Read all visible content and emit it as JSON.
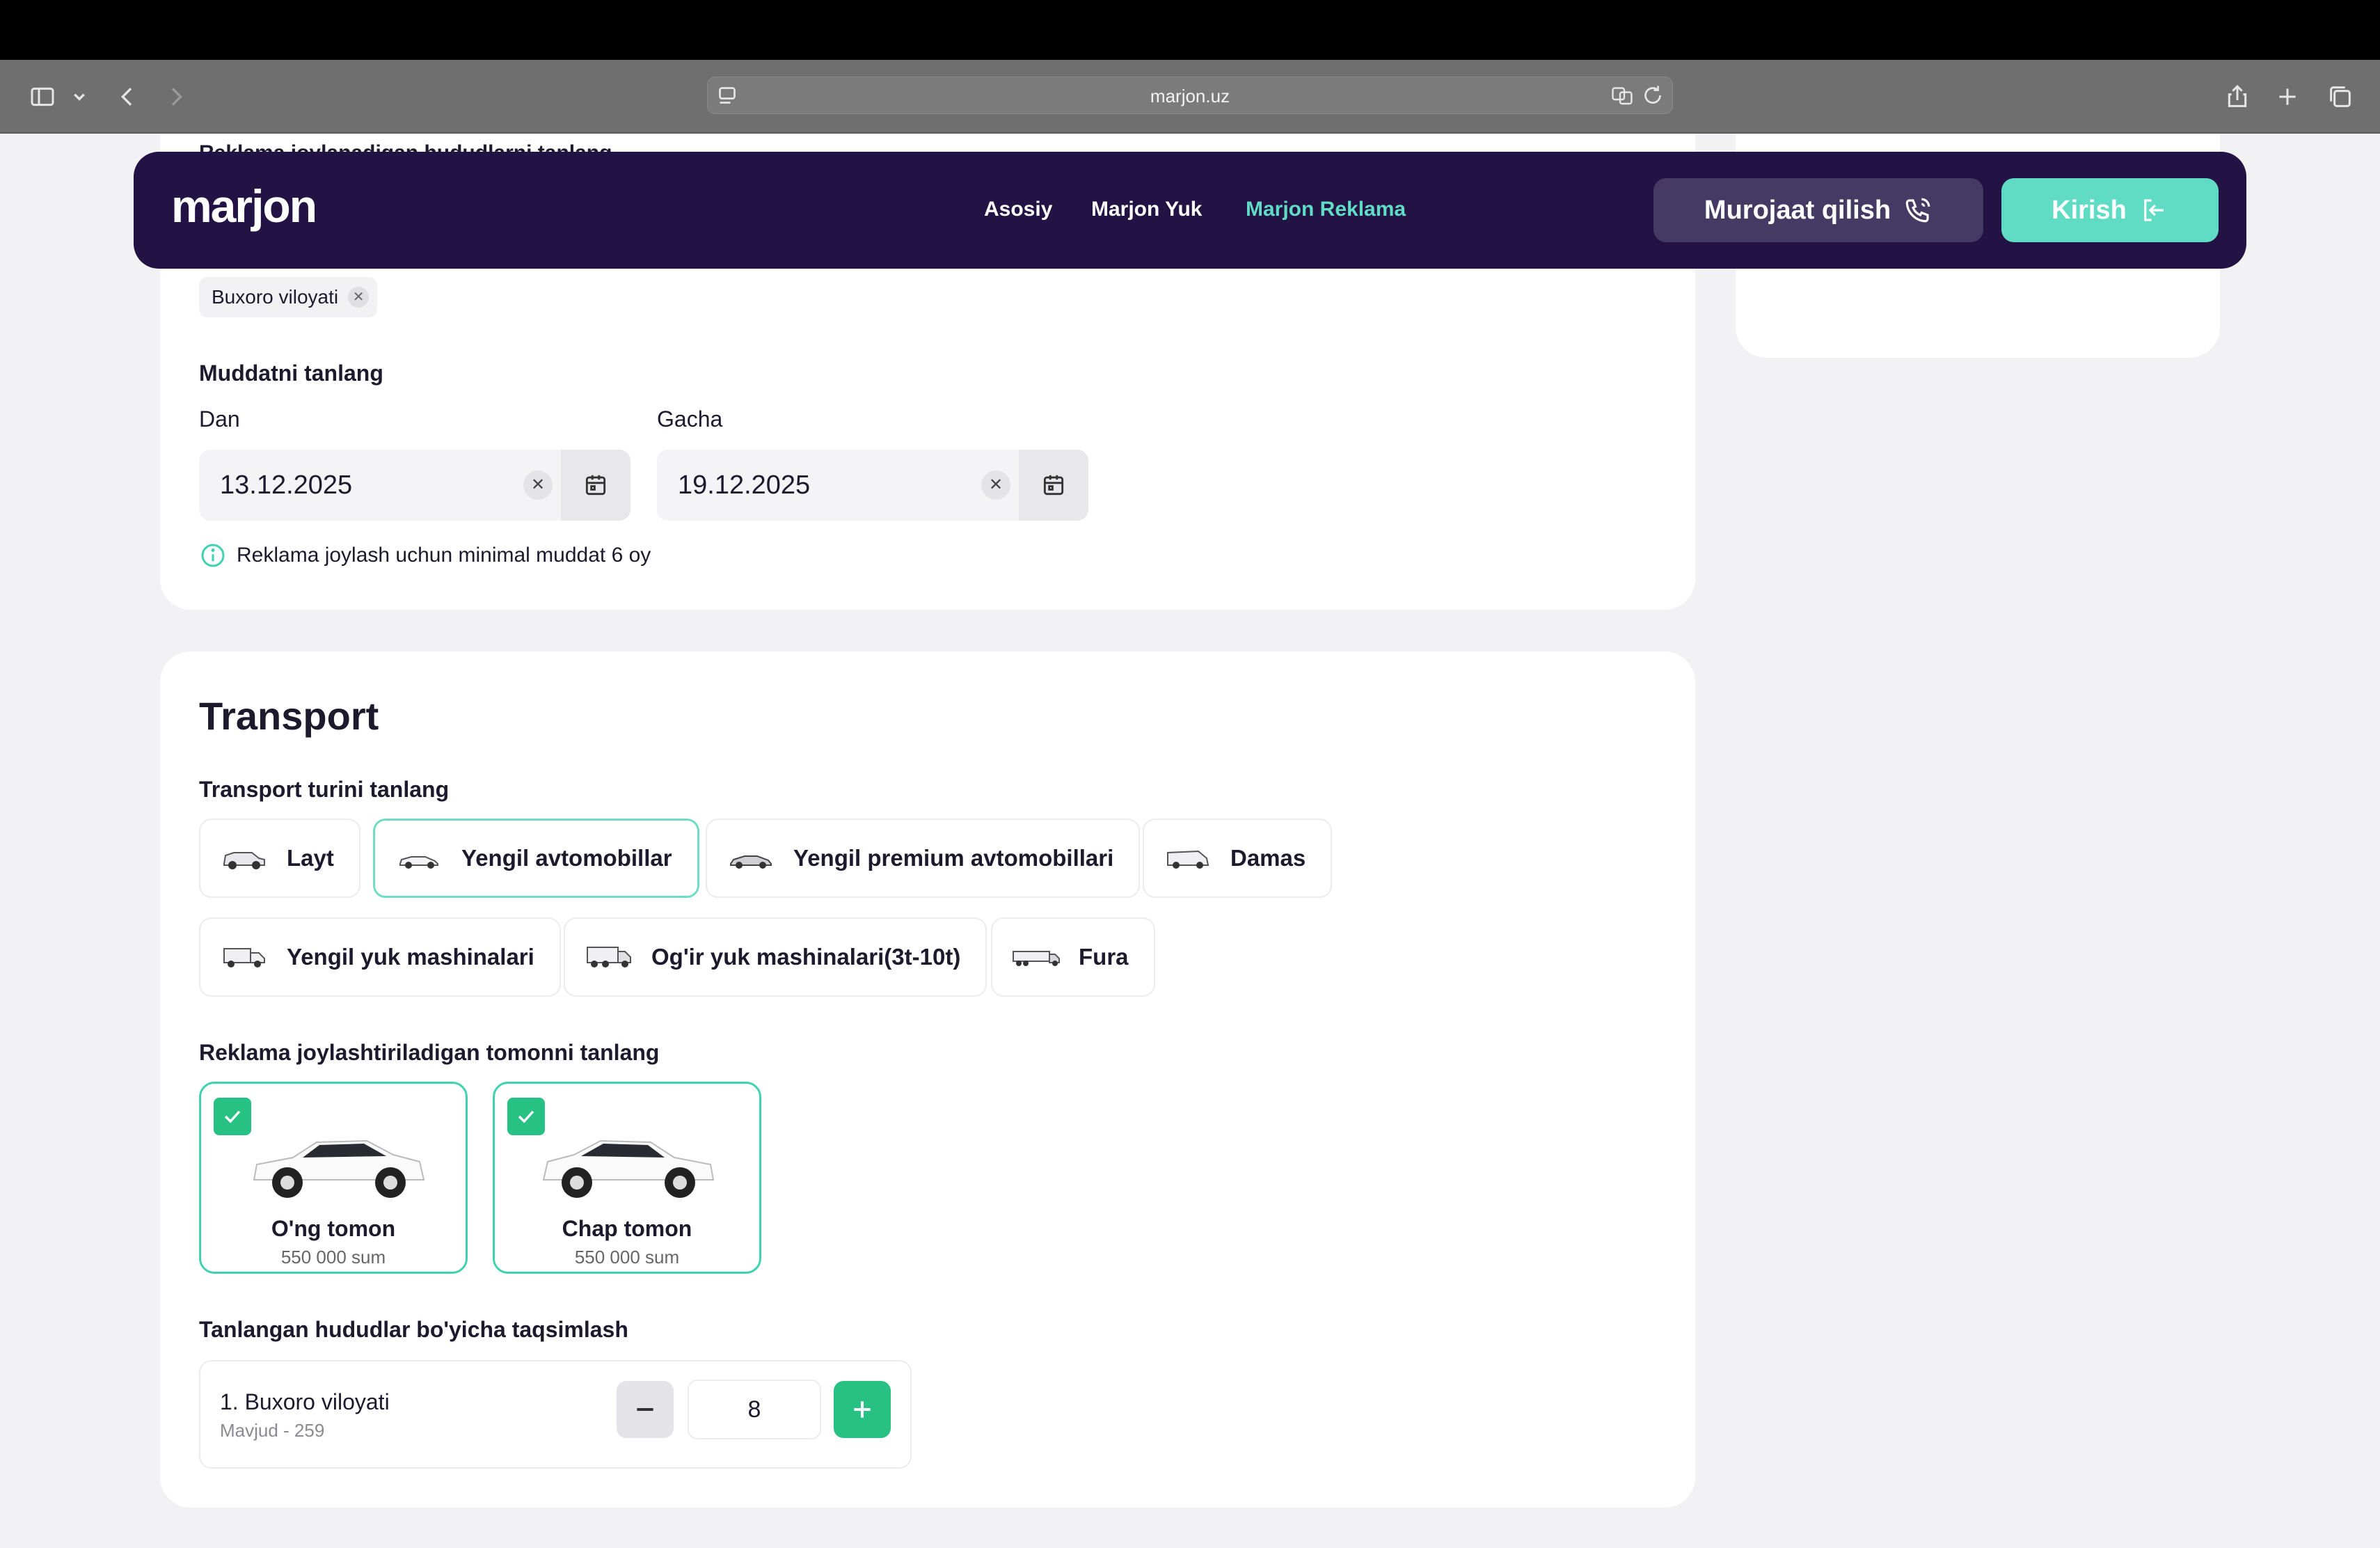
{
  "browser": {
    "url": "marjon.uz"
  },
  "peek_text": "Reklama joylanadigan hududlarni tanlang",
  "nav": {
    "logo": "marjon",
    "links": [
      "Asosiy",
      "Marjon Yuk",
      "Marjon Reklama"
    ],
    "active_link": "Marjon Reklama",
    "contact_label": "Murojaat qilish",
    "login_label": "Kirish"
  },
  "region_chip": "Buxoro viloyati",
  "period": {
    "title": "Muddatni tanlang",
    "from_label": "Dan",
    "to_label": "Gacha",
    "from_value": "13.12.2025",
    "to_value": "19.12.2025",
    "info": "Reklama joylash uchun minimal muddat 6 oy"
  },
  "transport": {
    "title": "Transport",
    "type_label": "Transport turini tanlang",
    "types": [
      "Layt",
      "Yengil avtomobillar",
      "Yengil premium avtomobillari",
      "Damas",
      "Yengil yuk mashinalari",
      "Og'ir yuk mashinalari(3t-10t)",
      "Fura"
    ],
    "selected_type": "Yengil avtomobillar",
    "side_label": "Reklama joylashtiriladigan tomonni tanlang",
    "sides": [
      {
        "title": "O'ng tomon",
        "price": "550 000 sum",
        "checked": true
      },
      {
        "title": "Chap tomon",
        "price": "550 000 sum",
        "checked": true
      }
    ],
    "distribution_label": "Tanlangan hududlar bo'yicha taqsimlash",
    "distribution": {
      "name": "1. Buxoro viloyati",
      "available": "Mavjud - 259",
      "quantity": "8"
    }
  },
  "colors": {
    "nav_bg": "#231344",
    "accent": "#5fdcc3",
    "check_green": "#27c283"
  }
}
